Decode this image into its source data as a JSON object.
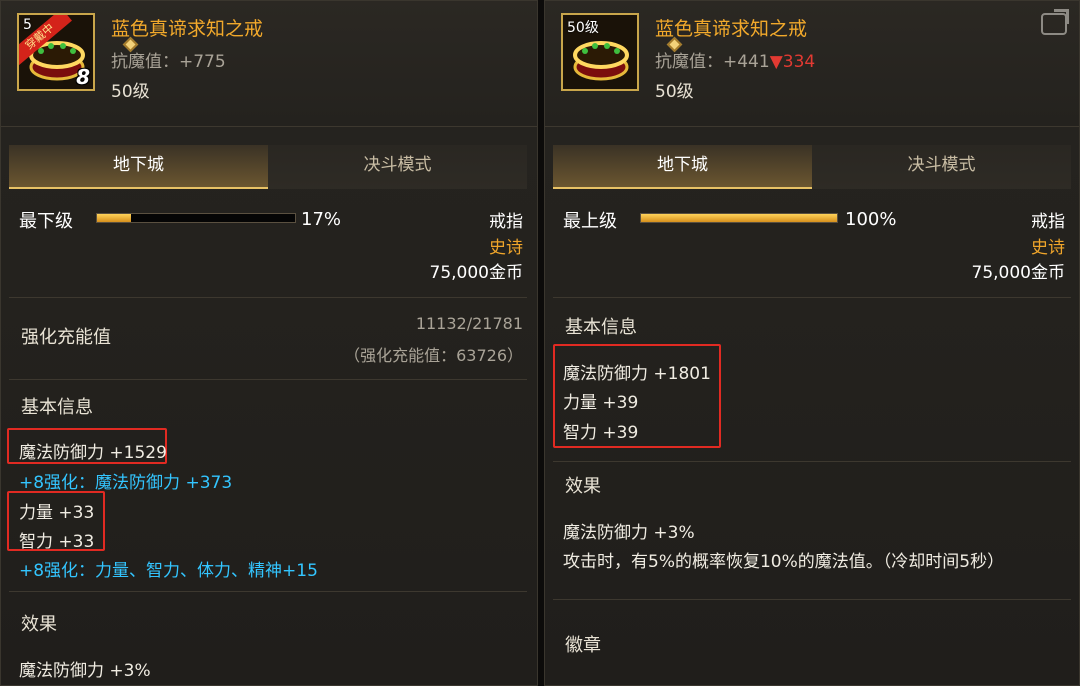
{
  "left": {
    "icon": {
      "level_text": "5",
      "ribbon": "穿戴中",
      "plus": "8"
    },
    "name": "蓝色真谛求知之戒",
    "resist": "抗魔值：+775",
    "item_level": "50级",
    "tabs": [
      "地下城",
      "决斗模式"
    ],
    "grade": "最下级",
    "grade_percent": "17%",
    "grade_fill": 0.17,
    "slot": "戒指",
    "rarity": "史诗",
    "price": "75,000金币",
    "charge_label": "强化充能值",
    "charge_value": "11132/21781",
    "charge_total": "（强化充能值：63726）",
    "basic_title": "基本信息",
    "stats": {
      "mdef": "魔法防御力 +1529",
      "mdef_bonus": "+8强化：魔法防御力 +373",
      "str": "力量 +33",
      "int": "智力 +33",
      "all_bonus": "+8强化：力量、智力、体力、精神+15"
    },
    "effect_title": "效果",
    "effect": "魔法防御力 +3%"
  },
  "right": {
    "icon": {
      "level_text": "50级"
    },
    "name": "蓝色真谛求知之戒",
    "resist_base": "抗魔值：+441",
    "resist_diff": "▼334",
    "item_level": "50级",
    "tabs": [
      "地下城",
      "决斗模式"
    ],
    "grade": "最上级",
    "grade_percent": "100%",
    "grade_fill": 1.0,
    "slot": "戒指",
    "rarity": "史诗",
    "price": "75,000金币",
    "basic_title": "基本信息",
    "stats": {
      "mdef": "魔法防御力 +1801",
      "str": "力量 +39",
      "int": "智力 +39"
    },
    "effect_title": "效果",
    "effect1": "魔法防御力 +3%",
    "effect2": "攻击时，有5%的概率恢复10%的魔法值。（冷却时间5秒）",
    "badge_title": "徽章"
  },
  "colors": {
    "name": "#f2a92b",
    "bonus": "#33c5ff",
    "highlight_box": "#e12a22",
    "diff_down": "#e23a32"
  }
}
